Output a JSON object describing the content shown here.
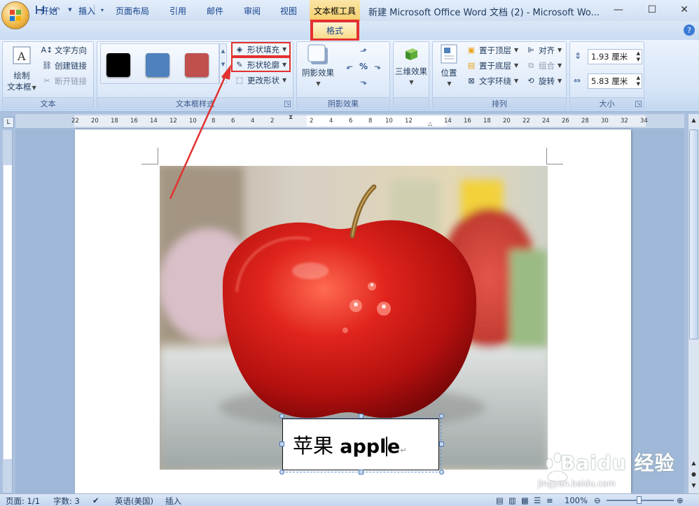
{
  "titlebar": {
    "context_tools": "文本框工具",
    "title": "新建 Microsoft Office Word 文档 (2) - Microsoft Wo...",
    "min_glyph": "—",
    "max_glyph": "☐",
    "close_glyph": "✕"
  },
  "quick_access": {
    "save_icon": "save-icon",
    "undo_icon": "undo-icon",
    "redo_icon": "redo-icon"
  },
  "tabs": [
    "开始",
    "插入",
    "页面布局",
    "引用",
    "邮件",
    "审阅",
    "视图"
  ],
  "active_tab": "格式",
  "ribbon": {
    "text_group": {
      "draw_textbox_line1": "绘制",
      "draw_textbox_line2": "文本框",
      "text_direction": "文字方向",
      "create_link": "创建链接",
      "break_link": "断开链接",
      "label": "文本"
    },
    "style_group": {
      "swatches": [
        "#000000",
        "#4f81bd",
        "#c0504d"
      ],
      "shape_fill": "形状填充",
      "shape_outline": "形状轮廓",
      "change_shape": "更改形状",
      "label": "文本框样式"
    },
    "shadow_group": {
      "shadow_effects": "阴影效果",
      "label": "阴影效果"
    },
    "threed_group": {
      "threed_effects": "三维效果"
    },
    "arrange_group": {
      "position": "位置",
      "bring_to_front": "置于顶层",
      "send_to_back": "置于底层",
      "text_wrap": "文字环绕",
      "align": "对齐",
      "group": "组合",
      "rotate": "旋转",
      "label": "排列"
    },
    "size_group": {
      "height": "1.93 厘米",
      "width": "5.83 厘米",
      "label": "大小"
    }
  },
  "ruler": {
    "left_ticks": [
      "22",
      "20",
      "18",
      "16",
      "14",
      "12",
      "10",
      "8",
      "6",
      "4",
      "2"
    ],
    "right_ticks": [
      "2",
      "4",
      "6",
      "8",
      "10",
      "12",
      "14",
      "16",
      "18",
      "20",
      "22",
      "24",
      "26",
      "28",
      "30",
      "32",
      "34"
    ]
  },
  "document": {
    "textbox_cn": "苹果",
    "textbox_en": "appl",
    "textbox_en_tail": "e",
    "para_mark": "↵"
  },
  "statusbar": {
    "page": "页面: 1/1",
    "words": "字数: 3",
    "language": "英语(美国)",
    "mode": "插入",
    "zoom": "100%"
  },
  "watermark": {
    "brand": "Baidu 经验",
    "url": "jingyan.baidu.com"
  },
  "colors": {
    "highlight": "#e3312f",
    "ribbon_bg": "#d5e4f7",
    "apple_red": "#d01c1c"
  }
}
